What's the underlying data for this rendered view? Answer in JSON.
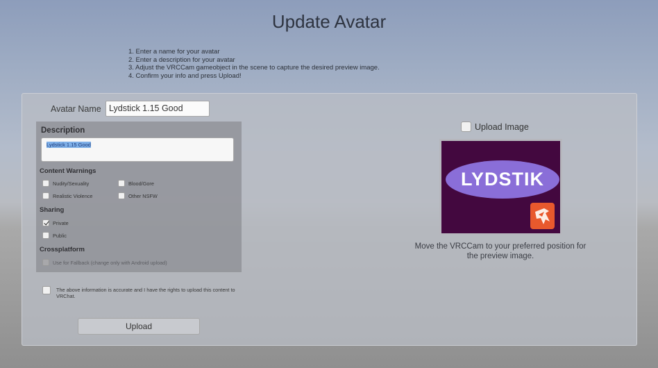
{
  "title": "Update Avatar",
  "instructions": [
    "1. Enter a name for your avatar",
    "2. Enter a description for your avatar",
    "3. Adjust the VRCCam gameobject in the scene to capture the desired preview image.",
    "4. Confirm your info and press Upload!"
  ],
  "avatar_name": {
    "label": "Avatar Name",
    "value": "Lydstick 1.15 Good"
  },
  "description": {
    "label": "Description",
    "value": "Lydstick 1.15 Good"
  },
  "content_warnings": {
    "label": "Content Warnings",
    "items": [
      {
        "label": "Nudity/Sexuality",
        "checked": false
      },
      {
        "label": "Blood/Gore",
        "checked": false
      },
      {
        "label": "Realistic Violence",
        "checked": false
      },
      {
        "label": "Other NSFW",
        "checked": false
      }
    ]
  },
  "sharing": {
    "label": "Sharing",
    "items": [
      {
        "label": "Private",
        "checked": true
      },
      {
        "label": "Public",
        "checked": false
      }
    ]
  },
  "crossplatform": {
    "label": "Crossplatform",
    "fallback_label": "Use for Fallback (change only with Android upload)",
    "enabled": false
  },
  "rights_confirmation": "The above information is accurate and I have the rights to upload this content to VRChat.",
  "upload_button": "Upload",
  "upload_image": {
    "label": "Upload Image",
    "checked": false
  },
  "preview": {
    "logo_text": "LYDSTIK",
    "caption": "Move the VRCCam to your preferred position for the preview image."
  },
  "colors": {
    "preview_bg": "#43083f",
    "logo_ellipse": "#8a6ed8",
    "corner_logo": "#e8592d"
  },
  "icons": [
    "checkbox-icon",
    "checkmark-icon",
    "corner-logo-icon"
  ]
}
